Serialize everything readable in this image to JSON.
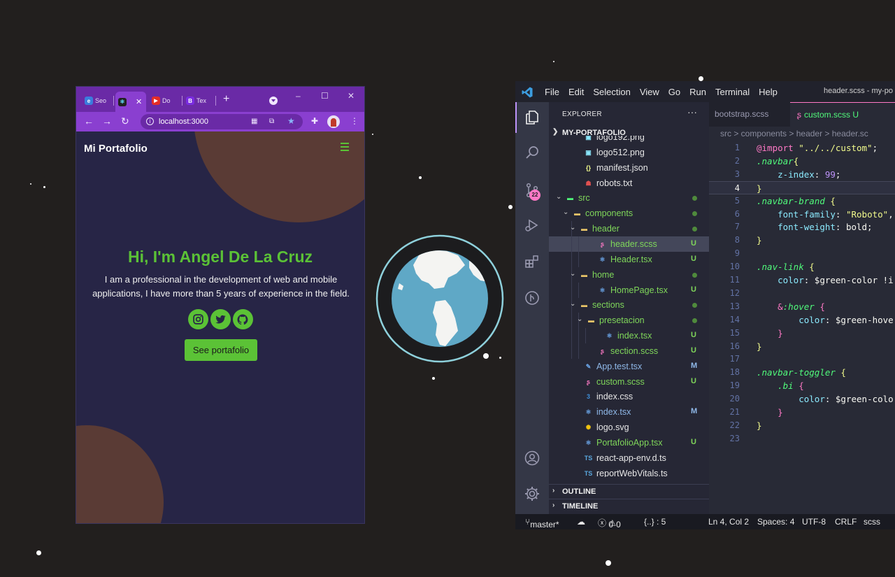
{
  "browser": {
    "tabs": [
      {
        "label": "Seo",
        "icon": "edge-icon"
      },
      {
        "label": "",
        "icon": "react-icon"
      },
      {
        "label": "Do",
        "icon": "youtube-icon"
      },
      {
        "label": "Tex",
        "icon": "bootstrap-icon"
      }
    ],
    "close_tab_glyph": "✕",
    "new_tab_glyph": "+",
    "url": "localhost:3000",
    "page": {
      "brand": "Mi Portafolio",
      "title": "Hi, I'm Angel De La Cruz",
      "text": "I am a professional in the development of web and mobile applications, I have more than 5 years of experience in the field.",
      "button": "See portafolio",
      "socials": [
        "instagram-icon",
        "twitter-icon",
        "github-icon"
      ],
      "accent": "#5bc236"
    }
  },
  "vscode": {
    "menu": [
      "File",
      "Edit",
      "Selection",
      "View",
      "Go",
      "Run",
      "Terminal",
      "Help"
    ],
    "window_title": "header.scss - my-po",
    "activity_badge": "22",
    "explorer": {
      "header": "EXPLORER",
      "more": "···",
      "root": "MY-PORTAFOLIO",
      "items": [
        {
          "name": "logo192.png",
          "depth": 2,
          "type": "image",
          "status": ""
        },
        {
          "name": "logo512.png",
          "depth": 2,
          "type": "image",
          "status": ""
        },
        {
          "name": "manifest.json",
          "depth": 2,
          "type": "json",
          "status": ""
        },
        {
          "name": "robots.txt",
          "depth": 2,
          "type": "robots",
          "status": ""
        },
        {
          "name": "src",
          "depth": 1,
          "type": "folder-src",
          "status": "dot",
          "open": true
        },
        {
          "name": "components",
          "depth": 2,
          "type": "folder",
          "status": "dot",
          "open": true
        },
        {
          "name": "header",
          "depth": 3,
          "type": "folder",
          "status": "dot",
          "open": true
        },
        {
          "name": "header.scss",
          "depth": 4,
          "type": "scss",
          "status": "U",
          "selected": true
        },
        {
          "name": "Header.tsx",
          "depth": 4,
          "type": "tsx",
          "status": "U"
        },
        {
          "name": "home",
          "depth": 3,
          "type": "folder",
          "status": "dot",
          "open": true
        },
        {
          "name": "HomePage.tsx",
          "depth": 4,
          "type": "tsx",
          "status": "U"
        },
        {
          "name": "sections",
          "depth": 3,
          "type": "folder",
          "status": "dot",
          "open": true
        },
        {
          "name": "presetacion",
          "depth": 4,
          "type": "folder",
          "status": "dot",
          "open": true
        },
        {
          "name": "index.tsx",
          "depth": 5,
          "type": "tsx",
          "status": "U"
        },
        {
          "name": "section.scss",
          "depth": 4,
          "type": "scss",
          "status": "U"
        },
        {
          "name": "App.test.tsx",
          "depth": 2,
          "type": "test",
          "status": "M"
        },
        {
          "name": "custom.scss",
          "depth": 2,
          "type": "scss",
          "status": "U"
        },
        {
          "name": "index.css",
          "depth": 2,
          "type": "css",
          "status": ""
        },
        {
          "name": "index.tsx",
          "depth": 2,
          "type": "tsx",
          "status": "M"
        },
        {
          "name": "logo.svg",
          "depth": 2,
          "type": "svg",
          "status": ""
        },
        {
          "name": "PortafolioApp.tsx",
          "depth": 2,
          "type": "tsx",
          "status": "U"
        },
        {
          "name": "react-app-env.d.ts",
          "depth": 2,
          "type": "ts",
          "status": ""
        },
        {
          "name": "reportWebVitals.ts",
          "depth": 2,
          "type": "ts",
          "status": ""
        }
      ],
      "outline": "OUTLINE",
      "timeline": "TIMELINE"
    },
    "tabs": [
      {
        "label": "bootstrap.scss",
        "active": false
      },
      {
        "label": "custom.scss U",
        "active": true
      }
    ],
    "breadcrumb": "src > components > header > header.sc",
    "current_line": 4,
    "code": [
      [
        [
          "c-at",
          "@import "
        ],
        [
          "c-str",
          "\"../../custom\""
        ],
        [
          "c-var",
          ";"
        ]
      ],
      [
        [
          "c-sel",
          ".navbar"
        ],
        [
          "c-br",
          "{"
        ]
      ],
      [
        [
          "c-var",
          "    "
        ],
        [
          "c-prop",
          "z-index"
        ],
        [
          "c-var",
          ": "
        ],
        [
          "c-num",
          "99"
        ],
        [
          "c-var",
          ";"
        ]
      ],
      [
        [
          "c-br",
          "}"
        ]
      ],
      [
        [
          "c-sel",
          ".navbar-brand "
        ],
        [
          "c-br",
          "{"
        ]
      ],
      [
        [
          "c-var",
          "    "
        ],
        [
          "c-prop",
          "font-family"
        ],
        [
          "c-var",
          ": "
        ],
        [
          "c-str",
          "\"Roboto\""
        ],
        [
          "c-var",
          ","
        ]
      ],
      [
        [
          "c-var",
          "    "
        ],
        [
          "c-prop",
          "font-weight"
        ],
        [
          "c-var",
          ": bold;"
        ]
      ],
      [
        [
          "c-br",
          "}"
        ]
      ],
      [],
      [
        [
          "c-sel",
          ".nav-link "
        ],
        [
          "c-br",
          "{"
        ]
      ],
      [
        [
          "c-var",
          "    "
        ],
        [
          "c-prop",
          "color"
        ],
        [
          "c-var",
          ": $green-color !i"
        ]
      ],
      [],
      [
        [
          "c-var",
          "    "
        ],
        [
          "c-at",
          "&"
        ],
        [
          "c-sel",
          ":hover "
        ],
        [
          "c-br2",
          "{"
        ]
      ],
      [
        [
          "c-var",
          "        "
        ],
        [
          "c-prop",
          "color"
        ],
        [
          "c-var",
          ": $green-hove"
        ]
      ],
      [
        [
          "c-var",
          "    "
        ],
        [
          "c-br2",
          "}"
        ]
      ],
      [
        [
          "c-br",
          "}"
        ]
      ],
      [],
      [
        [
          "c-sel",
          ".navbar-toggler "
        ],
        [
          "c-br",
          "{"
        ]
      ],
      [
        [
          "c-var",
          "    "
        ],
        [
          "c-sel",
          ".bi "
        ],
        [
          "c-br2",
          "{"
        ]
      ],
      [
        [
          "c-var",
          "        "
        ],
        [
          "c-prop",
          "color"
        ],
        [
          "c-var",
          ": $green-colo"
        ]
      ],
      [
        [
          "c-var",
          "    "
        ],
        [
          "c-br2",
          "}"
        ]
      ],
      [
        [
          "c-br",
          "}"
        ]
      ],
      []
    ],
    "status": {
      "branch": "master*",
      "problems": "0",
      "warnings": "0",
      "braces": "{..} : 5",
      "position": "Ln 4, Col 2",
      "spaces": "Spaces: 4",
      "encoding": "UTF-8",
      "eol": "CRLF",
      "language": "scss"
    }
  }
}
